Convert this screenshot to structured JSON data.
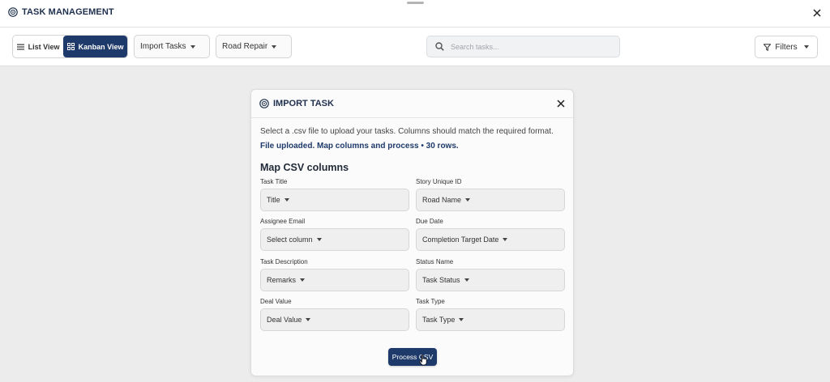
{
  "app": {
    "title": "TASK MANAGEMENT",
    "logo_icon": "globe-icon",
    "close_icon": "close-icon"
  },
  "toolbar": {
    "list_view_label": "List View",
    "kanban_view_label": "Kanban View",
    "import_tasks_label": "Import Tasks",
    "project_label": "Road Repair",
    "search_placeholder": "Search tasks...",
    "search_value": "",
    "filters_label": "Filters"
  },
  "modal": {
    "title": "IMPORT TASK",
    "description": "Select a .csv file to upload your tasks. Columns should match the required format.",
    "status_text": "File uploaded. Map columns and process • 30 rows.",
    "section_title": "Map CSV columns",
    "fields": [
      {
        "label": "Task Title",
        "value": "Title"
      },
      {
        "label": "Story Unique ID",
        "value": "Road Name"
      },
      {
        "label": "Assignee Email",
        "value": "Select column"
      },
      {
        "label": "Due Date",
        "value": "Completion Target Date"
      },
      {
        "label": "Task Description",
        "value": "Remarks"
      },
      {
        "label": "Status Name",
        "value": "Task Status"
      },
      {
        "label": "Deal Value",
        "value": "Deal Value"
      },
      {
        "label": "Task Type",
        "value": "Task Type"
      }
    ],
    "process_button_label": "Process CSV"
  },
  "colors": {
    "primary": "#1e3a6a",
    "title_text": "#1e2f4d",
    "background": "#ececec"
  }
}
